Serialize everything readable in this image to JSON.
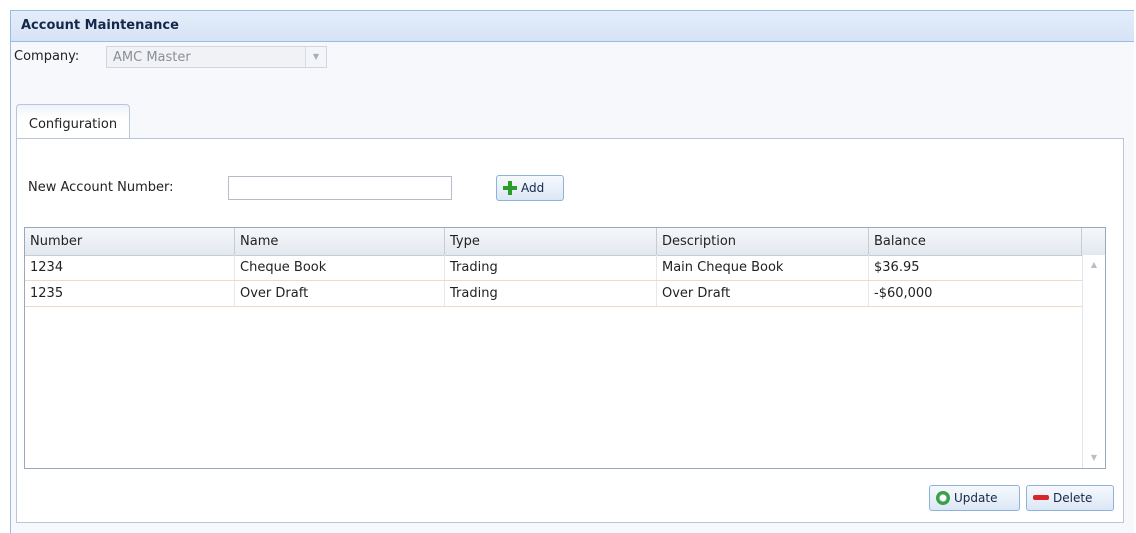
{
  "panel": {
    "title": "Account Maintenance"
  },
  "company": {
    "label": "Company:",
    "value": "AMC Master"
  },
  "tabs": [
    {
      "label": "Configuration"
    }
  ],
  "new_account": {
    "label": "New Account Number:",
    "value": "",
    "add_label": "Add"
  },
  "grid": {
    "columns": [
      "Number",
      "Name",
      "Type",
      "Description",
      "Balance"
    ],
    "rows": [
      [
        "1234",
        "Cheque Book",
        "Trading",
        "Main Cheque Book",
        "$36.95"
      ],
      [
        "1235",
        "Over Draft",
        "Trading",
        "Over Draft",
        "-$60,000"
      ]
    ]
  },
  "actions": {
    "update_label": "Update",
    "delete_label": "Delete"
  },
  "colors": {
    "accent": "#99bbe8",
    "add_icon": "#2a9d2a",
    "delete_icon": "#d8262d",
    "update_icon": "#3aa04a"
  }
}
